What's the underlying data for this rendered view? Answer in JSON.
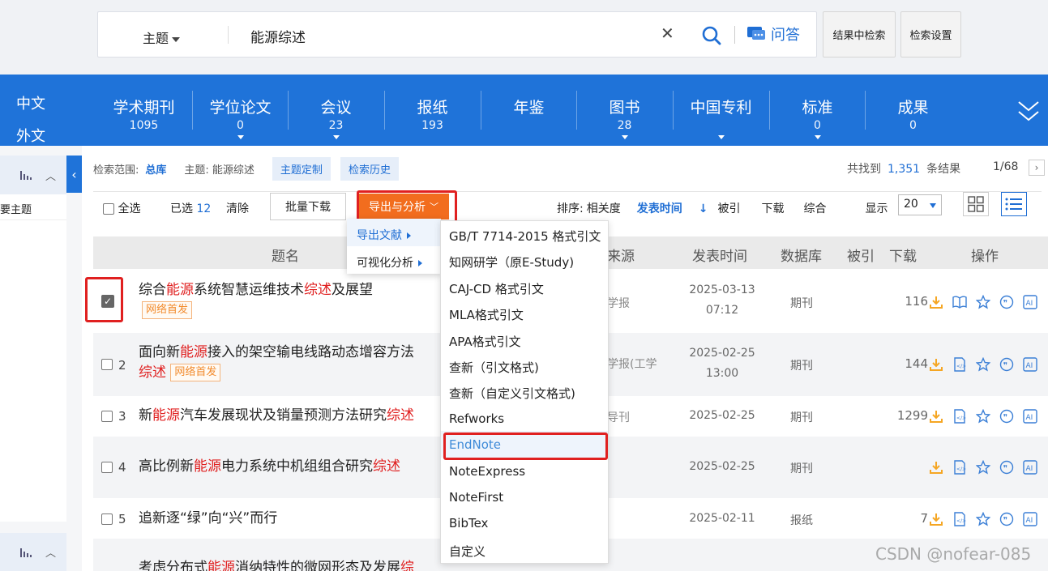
{
  "search": {
    "scope": "主题",
    "query": "能源综述",
    "qa_label": "问答",
    "btn_in_results": "结果中检索",
    "btn_settings": "检索设置"
  },
  "nav": {
    "lang_cn": "中文",
    "lang_foreign": "外文",
    "items": [
      {
        "label": "学术期刊",
        "count": "1095"
      },
      {
        "label": "学位论文",
        "count": "0"
      },
      {
        "label": "会议",
        "count": "23"
      },
      {
        "label": "报纸",
        "count": "193"
      },
      {
        "label": "年鉴",
        "count": ""
      },
      {
        "label": "图书",
        "count": "28"
      },
      {
        "label": "中国专利",
        "count": ""
      },
      {
        "label": "标准",
        "count": "0"
      },
      {
        "label": "成果",
        "count": "0"
      }
    ]
  },
  "sidebar": {
    "item": "要主题"
  },
  "scopebar": {
    "range_label": "检索范围:",
    "range_value": "总库",
    "topic": "主题: 能源综述",
    "chip_custom": "主题定制",
    "chip_history": "检索历史"
  },
  "results": {
    "found_prefix": "共找到",
    "found_count": "1,351",
    "found_suffix": "条结果",
    "page": "1/68"
  },
  "toolbar": {
    "select_all": "全选",
    "selected_label": "已选",
    "selected_count": "12",
    "clear": "清除",
    "batch_download": "批量下载",
    "export_analysis": "导出与分析",
    "sort_label": "排序:",
    "sort_relevance": "相关度",
    "sort_date": "发表时间",
    "sort_cited": "被引",
    "sort_download": "下载",
    "sort_composite": "综合",
    "display_label": "显示",
    "page_size": "20"
  },
  "table_header": {
    "title": "题名",
    "source": "来源",
    "date": "发表时间",
    "db": "数据库",
    "cited": "被引",
    "downloads": "下载",
    "ops": "操作"
  },
  "rows": [
    {
      "num": "",
      "t1": "综合",
      "t2": "能源",
      "t3": "系统智慧运维技术",
      "t4": "综述",
      "t5": "及展望",
      "tag": "网络首发",
      "source": "学报",
      "date1": "2025-03-13",
      "date2": "07:12",
      "db": "期刊",
      "downloads": "116"
    },
    {
      "num": "2",
      "t1": "面向新",
      "t2": "能源",
      "t3": "接入的架空输电线路动态增容方法",
      "t4": "综述",
      "t5": "",
      "tag": "网络首发",
      "source": "学报(工学",
      "date1": "2025-02-25",
      "date2": "13:00",
      "db": "期刊",
      "downloads": "144"
    },
    {
      "num": "3",
      "t1": "新",
      "t2": "能源",
      "t3": "汽车发展现状及销量预测方法研究",
      "t4": "综述",
      "t5": "",
      "tag": "",
      "source": "导刊",
      "date1": "2025-02-25",
      "date2": "",
      "db": "期刊",
      "downloads": "1299"
    },
    {
      "num": "4",
      "t1": "高比例新",
      "t2": "能源",
      "t3": "电力系统中机组组合研究",
      "t4": "综述",
      "t5": "",
      "tag": "",
      "source": "",
      "date1": "2025-02-25",
      "date2": "",
      "db": "期刊",
      "downloads": ""
    },
    {
      "num": "5",
      "t1": "追新逐“绿”向“兴”而行",
      "t2": "",
      "t3": "",
      "t4": "",
      "t5": "",
      "tag": "",
      "source": "",
      "date1": "2025-02-11",
      "date2": "",
      "db": "报纸",
      "downloads": "7"
    },
    {
      "num": "",
      "t1": "考虑分布式",
      "t2": "能源",
      "t3": "消纳特性的微网形态及发展",
      "t4": "综",
      "t5": "",
      "tag": "",
      "source": "",
      "date1": "",
      "date2": "",
      "db": "",
      "downloads": ""
    }
  ],
  "export_menu": {
    "export_docs": "导出文献",
    "visual_analysis": "可视化分析"
  },
  "format_menu": [
    "GB/T 7714-2015 格式引文",
    "知网研学（原E-Study)",
    "CAJ-CD 格式引文",
    "MLA格式引文",
    "APA格式引文",
    "查新（引文格式)",
    "查新（自定义引文格式)",
    "Refworks",
    "EndNote",
    "NoteExpress",
    "NoteFirst",
    "BibTex",
    "自定义"
  ],
  "watermark": "CSDN @nofear-085",
  "colors": {
    "nav_blue": "#1f73d9",
    "accent_orange": "#f26d1e",
    "highlight_red": "#e02020",
    "link_blue": "#1f6ed4"
  }
}
